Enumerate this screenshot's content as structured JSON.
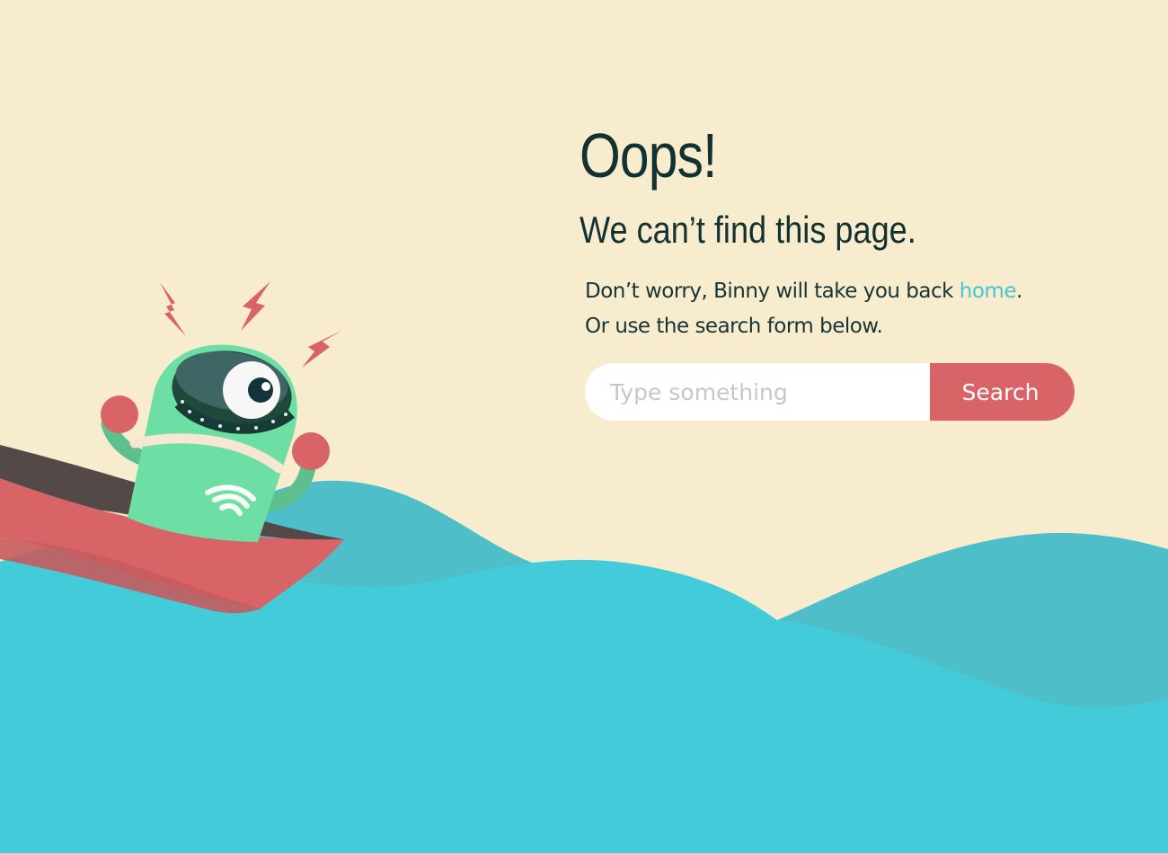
{
  "page": {
    "title": "Oops!",
    "subtitle": "We can’t find this page.",
    "message_line1_prefix": "Don’t worry, Binny will take you back ",
    "home_link": "home",
    "message_line1_suffix": ".",
    "message_line2": "Or use the search form below."
  },
  "search": {
    "placeholder": "Type something",
    "value": "",
    "button_label": "Search"
  },
  "illustration": {
    "character": "Binny",
    "icons": [
      "lightning-icon",
      "wifi-icon"
    ]
  },
  "colors": {
    "background": "#f8ecce",
    "heading": "#123232",
    "link": "#47c4d1",
    "search_button": "#d96467",
    "sea_front": "#44cbd9",
    "sea_back": "#4ebfc8",
    "robot": "#6ddea4",
    "boat": "#d96467"
  }
}
